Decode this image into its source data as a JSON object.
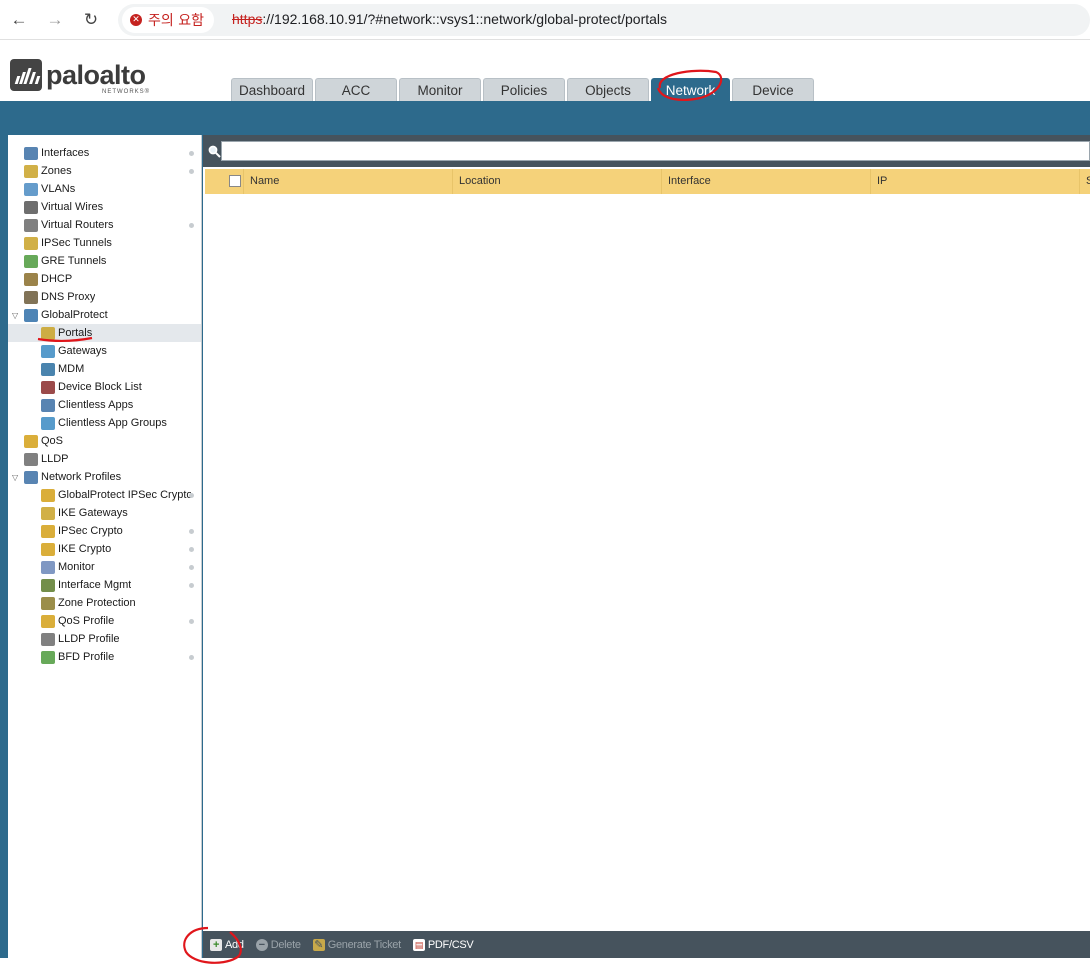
{
  "browser": {
    "back": "←",
    "forward": "→",
    "reload": "↻",
    "security_label": "주의 요함",
    "url_scheme": "https",
    "url_rest": "://192.168.10.91/?#network::vsys1::network/global-protect/portals"
  },
  "logo": {
    "text": "paloalto",
    "sub": "NETWORKS®"
  },
  "tabs": [
    {
      "label": "Dashboard"
    },
    {
      "label": "ACC"
    },
    {
      "label": "Monitor"
    },
    {
      "label": "Policies"
    },
    {
      "label": "Objects"
    },
    {
      "label": "Network",
      "active": true
    },
    {
      "label": "Device"
    }
  ],
  "sidebar": {
    "items": [
      {
        "label": "Interfaces",
        "icon": "interfaces-icon",
        "level": 0,
        "dot": true
      },
      {
        "label": "Zones",
        "icon": "zones-icon",
        "level": 0,
        "dot": true
      },
      {
        "label": "VLANs",
        "icon": "vlans-icon",
        "level": 0,
        "dot": false
      },
      {
        "label": "Virtual Wires",
        "icon": "virtual-wires-icon",
        "level": 0,
        "dot": false
      },
      {
        "label": "Virtual Routers",
        "icon": "virtual-routers-icon",
        "level": 0,
        "dot": true
      },
      {
        "label": "IPSec Tunnels",
        "icon": "ipsec-tunnels-icon",
        "level": 0,
        "dot": false
      },
      {
        "label": "GRE Tunnels",
        "icon": "gre-tunnels-icon",
        "level": 0,
        "dot": false
      },
      {
        "label": "DHCP",
        "icon": "dhcp-icon",
        "level": 0,
        "dot": false
      },
      {
        "label": "DNS Proxy",
        "icon": "dns-proxy-icon",
        "level": 0,
        "dot": false
      },
      {
        "label": "GlobalProtect",
        "icon": "globalprotect-icon",
        "level": 0,
        "dot": false,
        "expanded": true
      },
      {
        "label": "Portals",
        "icon": "portals-icon",
        "level": 1,
        "dot": false,
        "selected": true
      },
      {
        "label": "Gateways",
        "icon": "gateways-icon",
        "level": 1,
        "dot": false
      },
      {
        "label": "MDM",
        "icon": "mdm-icon",
        "level": 1,
        "dot": false
      },
      {
        "label": "Device Block List",
        "icon": "device-block-list-icon",
        "level": 1,
        "dot": false
      },
      {
        "label": "Clientless Apps",
        "icon": "clientless-apps-icon",
        "level": 1,
        "dot": false
      },
      {
        "label": "Clientless App Groups",
        "icon": "clientless-app-groups-icon",
        "level": 1,
        "dot": false
      },
      {
        "label": "QoS",
        "icon": "qos-icon",
        "level": 0,
        "dot": false
      },
      {
        "label": "LLDP",
        "icon": "lldp-icon",
        "level": 0,
        "dot": false
      },
      {
        "label": "Network Profiles",
        "icon": "network-profiles-icon",
        "level": 0,
        "dot": false,
        "expanded": true
      },
      {
        "label": "GlobalProtect IPSec Crypto",
        "icon": "lock-icon",
        "level": 1,
        "dot": true
      },
      {
        "label": "IKE Gateways",
        "icon": "ike-gateways-icon",
        "level": 1,
        "dot": false
      },
      {
        "label": "IPSec Crypto",
        "icon": "lock-icon",
        "level": 1,
        "dot": true
      },
      {
        "label": "IKE Crypto",
        "icon": "lock-icon",
        "level": 1,
        "dot": true
      },
      {
        "label": "Monitor",
        "icon": "monitor-profile-icon",
        "level": 1,
        "dot": true
      },
      {
        "label": "Interface Mgmt",
        "icon": "interface-mgmt-icon",
        "level": 1,
        "dot": true
      },
      {
        "label": "Zone Protection",
        "icon": "zone-protection-icon",
        "level": 1,
        "dot": false
      },
      {
        "label": "QoS Profile",
        "icon": "qos-profile-icon",
        "level": 1,
        "dot": true
      },
      {
        "label": "LLDP Profile",
        "icon": "lldp-profile-icon",
        "level": 1,
        "dot": false
      },
      {
        "label": "BFD Profile",
        "icon": "bfd-profile-icon",
        "level": 1,
        "dot": true
      }
    ]
  },
  "search": {
    "placeholder": ""
  },
  "table": {
    "columns": [
      "Name",
      "Location",
      "Interface",
      "IP",
      "S"
    ]
  },
  "footer": {
    "add": "Add",
    "delete": "Delete",
    "generate_ticket": "Generate Ticket",
    "pdf_csv": "PDF/CSV"
  },
  "colors": {
    "brand": "#2d6a8c",
    "header_row": "#f5d27a",
    "annotation": "#e0161b",
    "warning": "#c5221f"
  }
}
